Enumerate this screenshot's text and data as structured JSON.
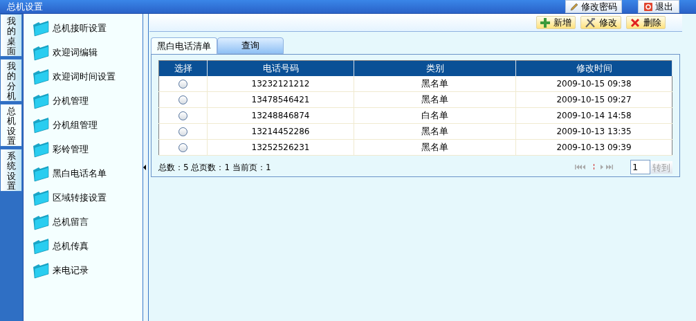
{
  "window": {
    "title": "总机设置"
  },
  "top_buttons": [
    {
      "label": "修改密码",
      "kind": "edit"
    },
    {
      "label": "退出",
      "kind": "exit"
    }
  ],
  "side_tabs": [
    {
      "label": "我的桌面",
      "selected": false
    },
    {
      "label": "我的分机",
      "selected": false
    },
    {
      "label": "总机设置",
      "selected": true
    },
    {
      "label": "系统设置",
      "selected": false
    }
  ],
  "menu": [
    "总机接听设置",
    "欢迎词编辑",
    "欢迎词时间设置",
    "分机管理",
    "分机组管理",
    "彩铃管理",
    "黑白电话名单",
    "区域转接设置",
    "总机留言",
    "总机传真",
    "来电记录"
  ],
  "toolbar": [
    {
      "label": "新增",
      "kind": "add"
    },
    {
      "label": "修改",
      "kind": "edit"
    },
    {
      "label": "删除",
      "kind": "delete"
    }
  ],
  "tabs": [
    {
      "label": "黑白电话清单",
      "selected": true
    },
    {
      "label": "查询",
      "selected": false
    }
  ],
  "table": {
    "columns": [
      "选择",
      "电话号码",
      "类别",
      "修改时间"
    ],
    "rows": [
      {
        "selected": false,
        "phone": "13232121212",
        "type": "黑名单",
        "time": "2009-10-15 09:38"
      },
      {
        "selected": false,
        "phone": "13478546421",
        "type": "黑名单",
        "time": "2009-10-15 09:27"
      },
      {
        "selected": false,
        "phone": "13248846874",
        "type": "白名单",
        "time": "2009-10-14 14:58"
      },
      {
        "selected": false,
        "phone": "13214452286",
        "type": "黑名单",
        "time": "2009-10-13 13:35"
      },
      {
        "selected": false,
        "phone": "13252526231",
        "type": "黑名单",
        "time": "2009-10-13 09:39"
      }
    ]
  },
  "summary": "总数：5 总页数：1 当前页：1",
  "pager": {
    "page": "1",
    "go": "转到",
    "go_disabled": true
  }
}
